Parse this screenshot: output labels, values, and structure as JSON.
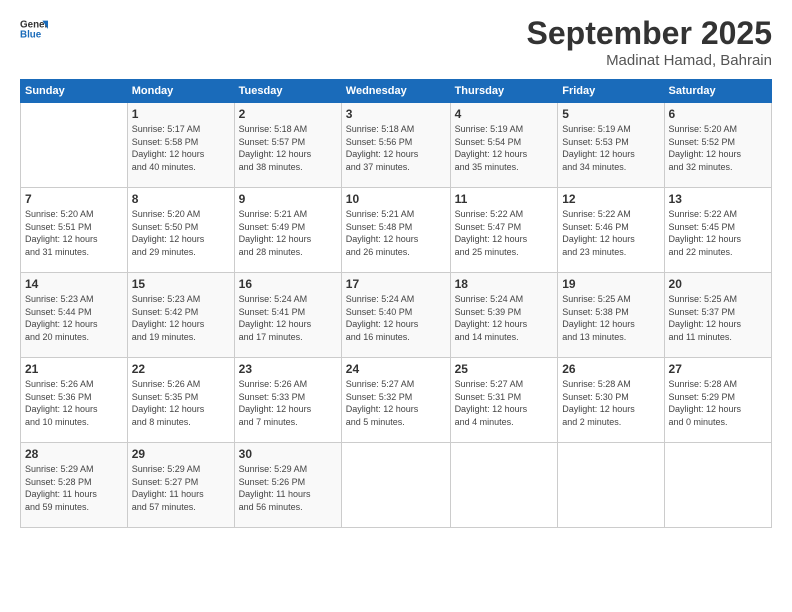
{
  "header": {
    "logo_line1": "General",
    "logo_line2": "Blue",
    "month": "September 2025",
    "location": "Madinat Hamad, Bahrain"
  },
  "weekdays": [
    "Sunday",
    "Monday",
    "Tuesday",
    "Wednesday",
    "Thursday",
    "Friday",
    "Saturday"
  ],
  "rows": [
    [
      {
        "day": "",
        "info": ""
      },
      {
        "day": "1",
        "info": "Sunrise: 5:17 AM\nSunset: 5:58 PM\nDaylight: 12 hours\nand 40 minutes."
      },
      {
        "day": "2",
        "info": "Sunrise: 5:18 AM\nSunset: 5:57 PM\nDaylight: 12 hours\nand 38 minutes."
      },
      {
        "day": "3",
        "info": "Sunrise: 5:18 AM\nSunset: 5:56 PM\nDaylight: 12 hours\nand 37 minutes."
      },
      {
        "day": "4",
        "info": "Sunrise: 5:19 AM\nSunset: 5:54 PM\nDaylight: 12 hours\nand 35 minutes."
      },
      {
        "day": "5",
        "info": "Sunrise: 5:19 AM\nSunset: 5:53 PM\nDaylight: 12 hours\nand 34 minutes."
      },
      {
        "day": "6",
        "info": "Sunrise: 5:20 AM\nSunset: 5:52 PM\nDaylight: 12 hours\nand 32 minutes."
      }
    ],
    [
      {
        "day": "7",
        "info": "Sunrise: 5:20 AM\nSunset: 5:51 PM\nDaylight: 12 hours\nand 31 minutes."
      },
      {
        "day": "8",
        "info": "Sunrise: 5:20 AM\nSunset: 5:50 PM\nDaylight: 12 hours\nand 29 minutes."
      },
      {
        "day": "9",
        "info": "Sunrise: 5:21 AM\nSunset: 5:49 PM\nDaylight: 12 hours\nand 28 minutes."
      },
      {
        "day": "10",
        "info": "Sunrise: 5:21 AM\nSunset: 5:48 PM\nDaylight: 12 hours\nand 26 minutes."
      },
      {
        "day": "11",
        "info": "Sunrise: 5:22 AM\nSunset: 5:47 PM\nDaylight: 12 hours\nand 25 minutes."
      },
      {
        "day": "12",
        "info": "Sunrise: 5:22 AM\nSunset: 5:46 PM\nDaylight: 12 hours\nand 23 minutes."
      },
      {
        "day": "13",
        "info": "Sunrise: 5:22 AM\nSunset: 5:45 PM\nDaylight: 12 hours\nand 22 minutes."
      }
    ],
    [
      {
        "day": "14",
        "info": "Sunrise: 5:23 AM\nSunset: 5:44 PM\nDaylight: 12 hours\nand 20 minutes."
      },
      {
        "day": "15",
        "info": "Sunrise: 5:23 AM\nSunset: 5:42 PM\nDaylight: 12 hours\nand 19 minutes."
      },
      {
        "day": "16",
        "info": "Sunrise: 5:24 AM\nSunset: 5:41 PM\nDaylight: 12 hours\nand 17 minutes."
      },
      {
        "day": "17",
        "info": "Sunrise: 5:24 AM\nSunset: 5:40 PM\nDaylight: 12 hours\nand 16 minutes."
      },
      {
        "day": "18",
        "info": "Sunrise: 5:24 AM\nSunset: 5:39 PM\nDaylight: 12 hours\nand 14 minutes."
      },
      {
        "day": "19",
        "info": "Sunrise: 5:25 AM\nSunset: 5:38 PM\nDaylight: 12 hours\nand 13 minutes."
      },
      {
        "day": "20",
        "info": "Sunrise: 5:25 AM\nSunset: 5:37 PM\nDaylight: 12 hours\nand 11 minutes."
      }
    ],
    [
      {
        "day": "21",
        "info": "Sunrise: 5:26 AM\nSunset: 5:36 PM\nDaylight: 12 hours\nand 10 minutes."
      },
      {
        "day": "22",
        "info": "Sunrise: 5:26 AM\nSunset: 5:35 PM\nDaylight: 12 hours\nand 8 minutes."
      },
      {
        "day": "23",
        "info": "Sunrise: 5:26 AM\nSunset: 5:33 PM\nDaylight: 12 hours\nand 7 minutes."
      },
      {
        "day": "24",
        "info": "Sunrise: 5:27 AM\nSunset: 5:32 PM\nDaylight: 12 hours\nand 5 minutes."
      },
      {
        "day": "25",
        "info": "Sunrise: 5:27 AM\nSunset: 5:31 PM\nDaylight: 12 hours\nand 4 minutes."
      },
      {
        "day": "26",
        "info": "Sunrise: 5:28 AM\nSunset: 5:30 PM\nDaylight: 12 hours\nand 2 minutes."
      },
      {
        "day": "27",
        "info": "Sunrise: 5:28 AM\nSunset: 5:29 PM\nDaylight: 12 hours\nand 0 minutes."
      }
    ],
    [
      {
        "day": "28",
        "info": "Sunrise: 5:29 AM\nSunset: 5:28 PM\nDaylight: 11 hours\nand 59 minutes."
      },
      {
        "day": "29",
        "info": "Sunrise: 5:29 AM\nSunset: 5:27 PM\nDaylight: 11 hours\nand 57 minutes."
      },
      {
        "day": "30",
        "info": "Sunrise: 5:29 AM\nSunset: 5:26 PM\nDaylight: 11 hours\nand 56 minutes."
      },
      {
        "day": "",
        "info": ""
      },
      {
        "day": "",
        "info": ""
      },
      {
        "day": "",
        "info": ""
      },
      {
        "day": "",
        "info": ""
      }
    ]
  ]
}
